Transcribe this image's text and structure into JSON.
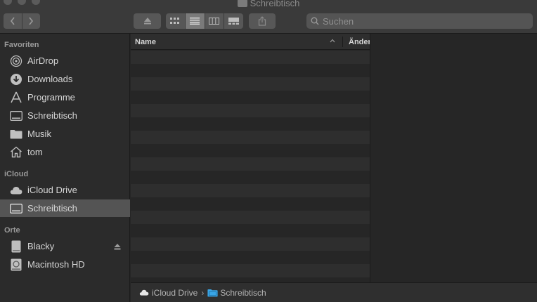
{
  "window": {
    "title": "Schreibtisch"
  },
  "toolbar": {
    "back_icon": "chevron-left-icon",
    "forward_icon": "chevron-right-icon",
    "eject_icon": "eject-icon",
    "views": [
      "icon-view-icon",
      "list-view-icon",
      "column-view-icon",
      "gallery-view-icon"
    ],
    "active_view": "list-view-icon",
    "share_icon": "share-icon"
  },
  "search": {
    "placeholder": "Suchen",
    "value": ""
  },
  "sidebar": {
    "sections": [
      {
        "title": "Favoriten",
        "items": [
          {
            "label": "AirDrop",
            "icon": "airdrop-icon"
          },
          {
            "label": "Downloads",
            "icon": "downloads-icon"
          },
          {
            "label": "Programme",
            "icon": "applications-icon"
          },
          {
            "label": "Schreibtisch",
            "icon": "desktop-icon"
          },
          {
            "label": "Musik",
            "icon": "folder-icon"
          },
          {
            "label": "tom",
            "icon": "home-icon"
          }
        ]
      },
      {
        "title": "iCloud",
        "items": [
          {
            "label": "iCloud Drive",
            "icon": "cloud-icon"
          },
          {
            "label": "Schreibtisch",
            "icon": "desktop-icon",
            "selected": true
          }
        ]
      },
      {
        "title": "Orte",
        "items": [
          {
            "label": "Blacky",
            "icon": "external-drive-icon",
            "eject": true
          },
          {
            "label": "Macintosh HD",
            "icon": "hard-drive-icon"
          }
        ]
      }
    ]
  },
  "list": {
    "columns": [
      {
        "label": "Name",
        "sort": "ascending"
      },
      {
        "label": "Änder"
      }
    ],
    "rows": []
  },
  "pathbar": {
    "items": [
      {
        "label": "iCloud Drive",
        "icon": "cloud-icon"
      },
      {
        "label": "Schreibtisch",
        "icon": "folder-icon"
      }
    ]
  },
  "colors": {
    "toolbar_bg": "#3a3a3a",
    "sidebar_bg": "#2b2b2b",
    "selection": "#545454",
    "folder_blue": "#3aa6e6"
  }
}
